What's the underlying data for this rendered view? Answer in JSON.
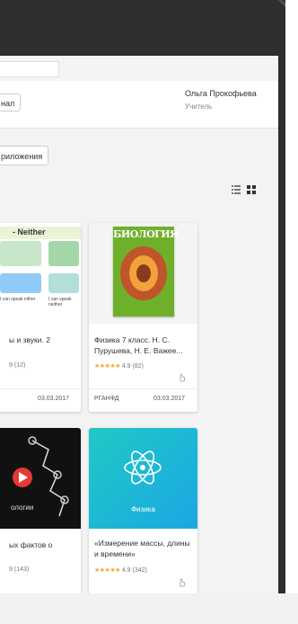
{
  "header": {
    "left_button_label": "нал",
    "user_name": "Ольга Прокофьева",
    "user_role": "Учитель"
  },
  "toolbar": {
    "apps_button_label": "риложения"
  },
  "view_toggle": {
    "icons": [
      "list-view-icon",
      "grid-view-icon"
    ]
  },
  "cards": [
    {
      "title": "ы и звуки. 2",
      "rating_value": "9",
      "rating_count": "(12)",
      "date": "03.03.2017",
      "cover_text": [
        "- Neither",
        "I can speak either",
        "I can speak neither"
      ]
    },
    {
      "title": "Физика 7 класс. Н. С. Пурушева, Н. Е. Важее...",
      "stars": "★★★★★",
      "rating_value": "4.9",
      "rating_count": "(82)",
      "publisher": "РГАНФД",
      "date": "03.03.2017",
      "cover_text": "БИОЛОГИЯ"
    },
    {
      "title": "ых фактов о",
      "rating_value": "9",
      "rating_count": "(143)",
      "cover_label": "ологии"
    },
    {
      "title": "«Измерение массы, длины и времени»",
      "stars": "★★★★★",
      "rating_value": "4.9",
      "rating_count": "(342)",
      "cover_label": "Физика"
    }
  ],
  "colors": {
    "device_bezel": "#2f2f2f",
    "accent_cyan": "#1bb3e0",
    "star": "#f5a623",
    "play_button": "#e53935"
  }
}
